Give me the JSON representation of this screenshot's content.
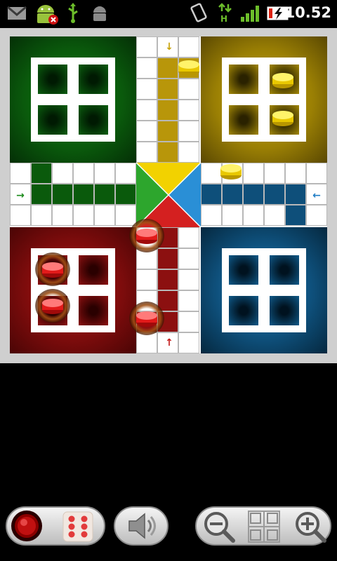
{
  "status_bar": {
    "time": "10.52",
    "icons": [
      "gmail-icon",
      "android-alert-icon",
      "usb-icon",
      "android-debug-icon",
      "rotate-icon",
      "hspa-data-icon",
      "signal-icon",
      "battery-charging-icon"
    ]
  },
  "board": {
    "colors": {
      "green": "#0a5a0c",
      "yellow": "#b8960a",
      "red": "#8c1010",
      "blue": "#0e4f7a",
      "center_top": "#f2d200",
      "center_right": "#2a8fd6",
      "center_bottom": "#d42020",
      "center_left": "#2da62d"
    },
    "arrow_glyphs": {
      "yellow": "↓",
      "green": "→",
      "blue": "←",
      "red": "↑"
    },
    "tokens": {
      "yellow": 4,
      "red": 4
    }
  },
  "controls": {
    "record_button_icon": "record-icon",
    "dice_icon": "dice-six-icon",
    "sound_icon": "speaker-icon",
    "zoom_out_icon": "zoom-out-icon",
    "board_view_icon": "board-grid-icon",
    "zoom_in_icon": "zoom-in-icon"
  }
}
